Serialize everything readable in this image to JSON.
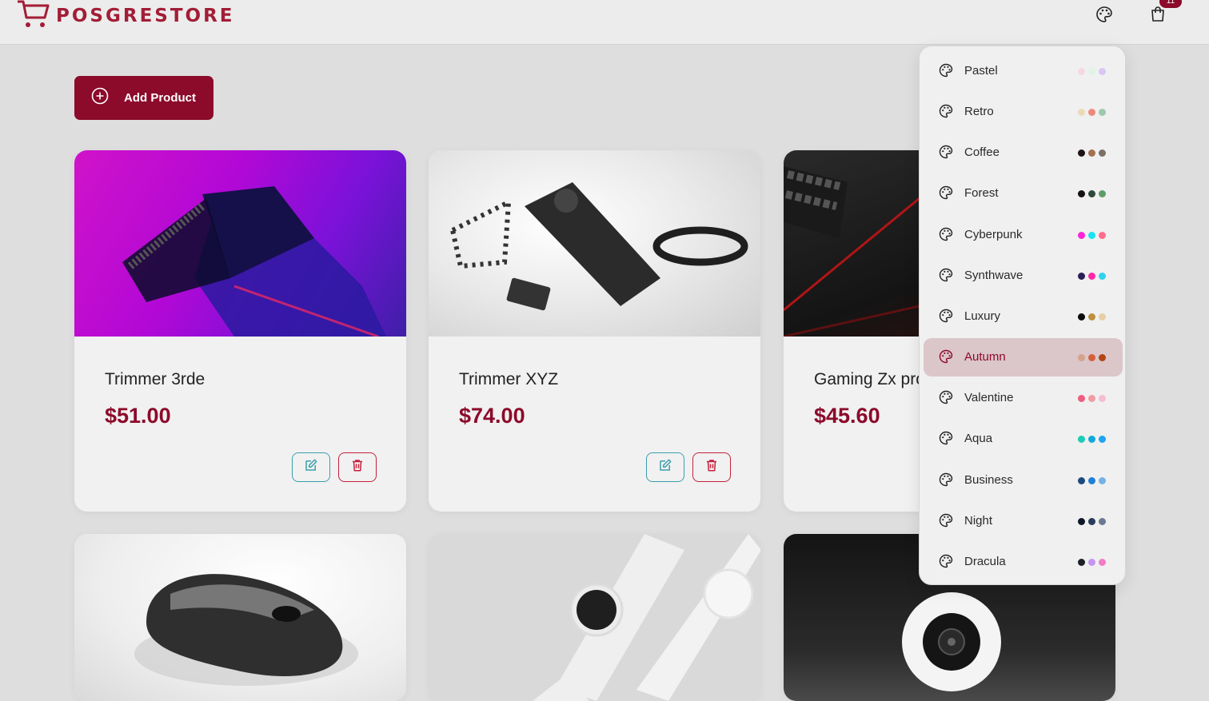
{
  "navbar": {
    "brand": "POSGRESTORE",
    "cart_badge": "11"
  },
  "add_button": {
    "label": "Add Product"
  },
  "products": [
    {
      "name": "Trimmer 3rde",
      "price": "$51.00",
      "image": "purple-trimmer"
    },
    {
      "name": "Trimmer XYZ",
      "price": "$74.00",
      "image": "black-trimmer-kit"
    },
    {
      "name": "Gaming Zx pro",
      "price": "$45.60",
      "image": "gaming-keyboard"
    },
    {
      "name": "",
      "price": "",
      "image": "wireless-mouse"
    },
    {
      "name": "",
      "price": "",
      "image": "smart-watches"
    },
    {
      "name": "",
      "price": "",
      "image": "security-camera"
    }
  ],
  "themes": [
    {
      "label": "Pastel",
      "colors": [
        "#f6d8e1",
        "#dff3e6",
        "#d8c6f4"
      ]
    },
    {
      "label": "Retro",
      "colors": [
        "#ecd9b7",
        "#ec8a7c",
        "#9cc8ac"
      ]
    },
    {
      "label": "Coffee",
      "colors": [
        "#201515",
        "#a37050",
        "#7c7064"
      ]
    },
    {
      "label": "Forest",
      "colors": [
        "#171212",
        "#2d4a3b",
        "#5e9b6a"
      ]
    },
    {
      "label": "Cyberpunk",
      "colors": [
        "#ff23d9",
        "#18e3f2",
        "#ff6d8a"
      ]
    },
    {
      "label": "Synthwave",
      "colors": [
        "#2c1e56",
        "#ff28a6",
        "#2ed2f0"
      ]
    },
    {
      "label": "Luxury",
      "colors": [
        "#0b0b0b",
        "#be8f3c",
        "#e7cfa4"
      ]
    },
    {
      "label": "Autumn",
      "colors": [
        "#d5a28b",
        "#d2613c",
        "#b14614"
      ]
    },
    {
      "label": "Valentine",
      "colors": [
        "#ef5d7f",
        "#f29ba1",
        "#f4bed3"
      ]
    },
    {
      "label": "Aqua",
      "colors": [
        "#1ccdb7",
        "#12a8dc",
        "#1fa4f2"
      ]
    },
    {
      "label": "Business",
      "colors": [
        "#1c4b7c",
        "#1f80d7",
        "#77b2e6"
      ]
    },
    {
      "label": "Night",
      "colors": [
        "#0f1829",
        "#2b3b5d",
        "#6b7892"
      ]
    },
    {
      "label": "Dracula",
      "colors": [
        "#1d2128",
        "#c495f3",
        "#f27bc8"
      ]
    }
  ],
  "active_theme": "Autumn",
  "colors": {
    "primary": "#8c0a2a",
    "brand": "#a31d36",
    "edit": "#3a9fae",
    "delete": "#c4203d"
  }
}
